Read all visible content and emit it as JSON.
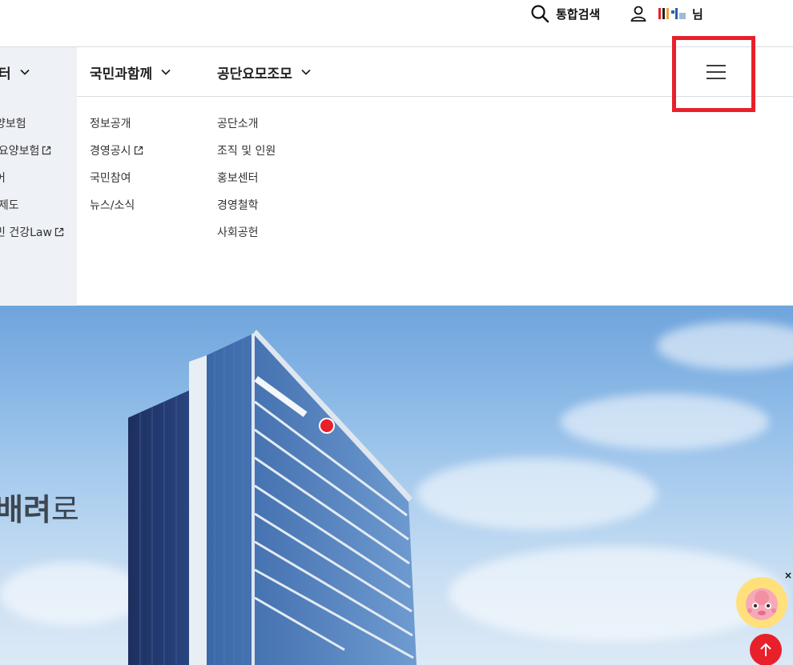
{
  "utility": {
    "search_label": "통합검색",
    "user_name_suffix": "님"
  },
  "gnb": {
    "items": [
      {
        "label": "터"
      },
      {
        "label": "국민과함께"
      },
      {
        "label": "공단요모조모"
      }
    ]
  },
  "dropdown": {
    "col0": [
      "양보험",
      "l요양보험",
      "어",
      "l제도",
      "민 건강Law"
    ],
    "col1": [
      "정보공개",
      "경영공시",
      "국민참여",
      "뉴스/소식"
    ],
    "col2": [
      "공단소개",
      "조직 및 인원",
      "홍보센터",
      "경영철학",
      "사회공헌"
    ]
  },
  "hero": {
    "headline_bold": "배려",
    "headline_light": "로"
  },
  "colors": {
    "accent_red": "#e8202a",
    "gnb_bg": "#eef1f5"
  }
}
